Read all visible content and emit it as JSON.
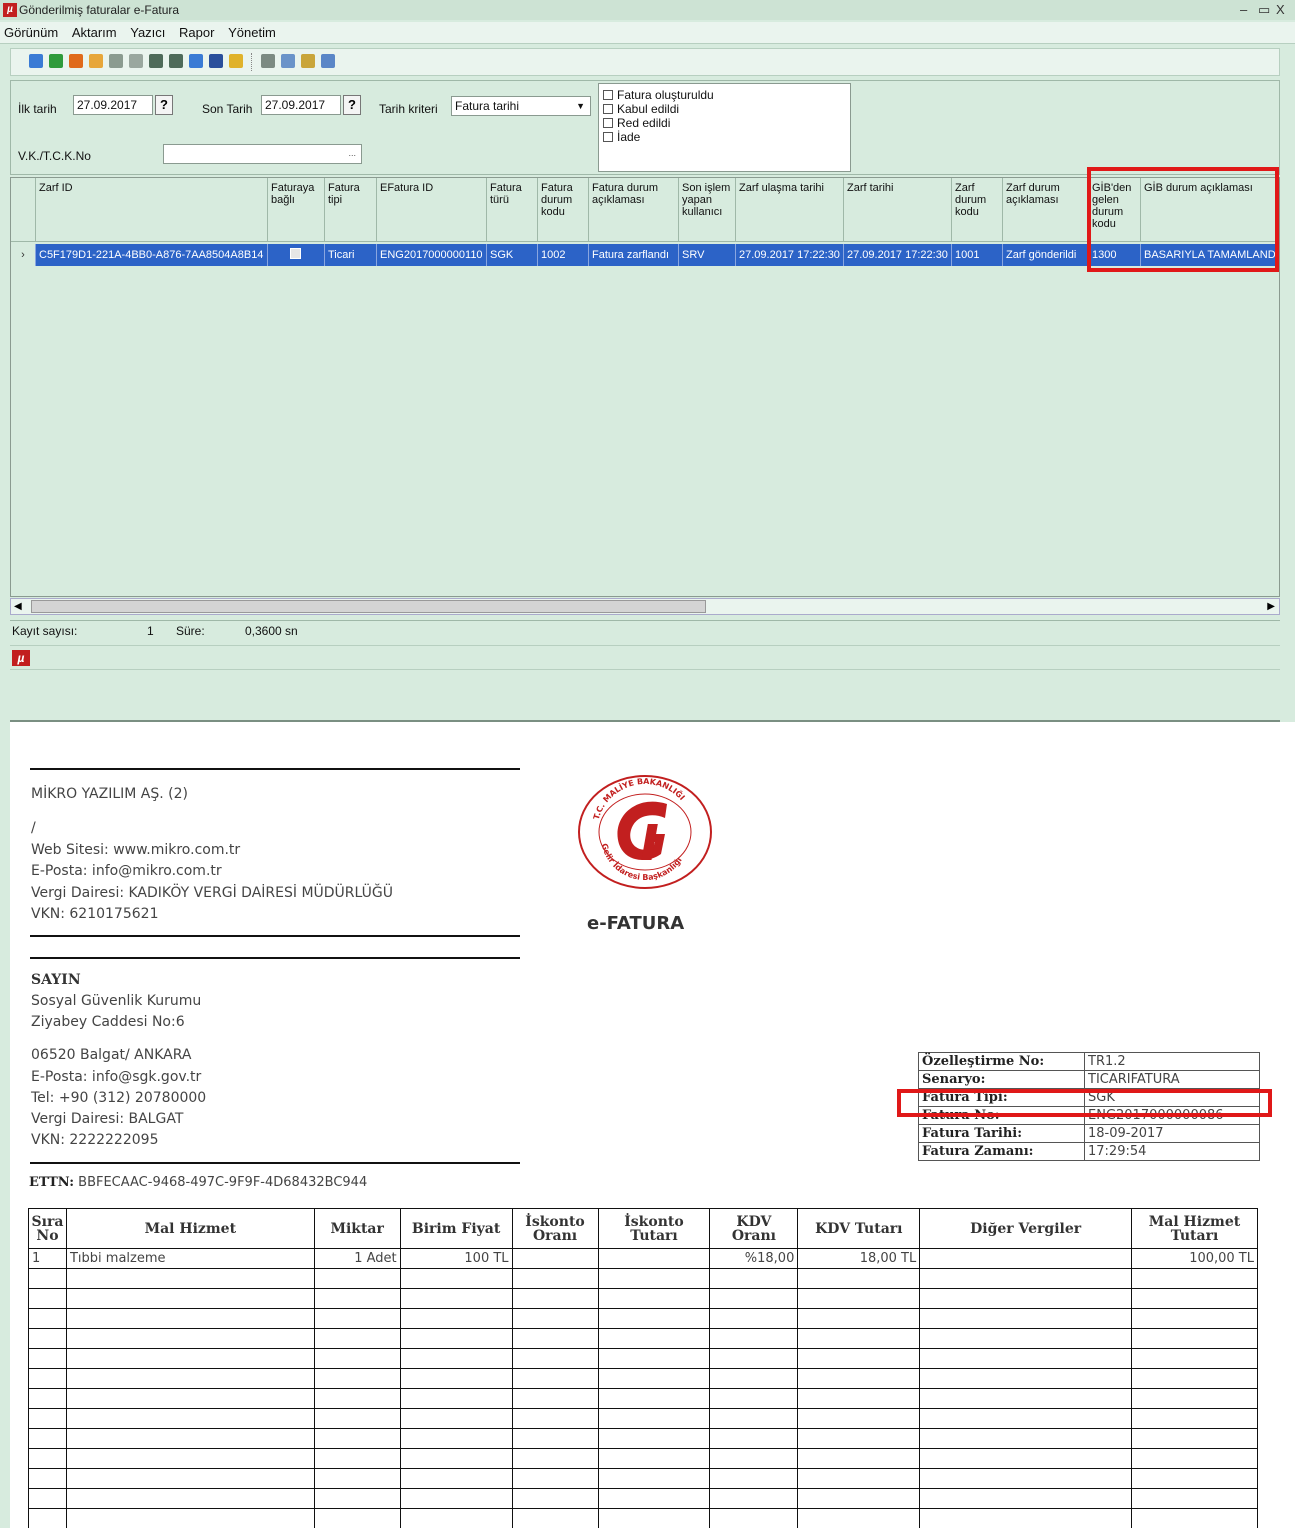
{
  "window": {
    "title": "Gönderilmiş faturalar e-Fatura",
    "controls": [
      "–",
      "▭",
      "X"
    ]
  },
  "menu": [
    "Görünüm",
    "Aktarım",
    "Yazıcı",
    "Rapor",
    "Yönetim"
  ],
  "filters": {
    "ilk_tarih_label": "İlk tarih",
    "ilk_tarih": "27.09.2017",
    "son_tarih_label": "Son Tarih",
    "son_tarih": "27.09.2017",
    "q": "?",
    "tarih_kriteri_label": "Tarih kriteri",
    "tarih_kriteri": "Fatura tarihi",
    "vkn_label": "V.K./T.C.K.No",
    "vkn_value": "",
    "ellipsis": "...",
    "status_options": [
      "Fatura oluşturuldu",
      "Kabul edildi",
      "Red edildi",
      "İade"
    ]
  },
  "grid": {
    "headers": [
      "Zarf ID",
      "Faturaya bağlı",
      "Fatura tipi",
      "EFatura ID",
      "Fatura türü",
      "Fatura durum kodu",
      "Fatura durum açıklaması",
      "Son işlem yapan kullanıcı",
      "Zarf ulaşma tarihi",
      "Zarf tarihi",
      "Zarf durum kodu",
      "Zarf durum açıklaması",
      "GİB'den gelen durum kodu",
      "GİB durum açıklaması"
    ],
    "row": [
      "C5F179D1-221A-4BB0-A876-7AA8504A8B14",
      "",
      "Ticari",
      "ENG2017000000110",
      "SGK",
      "1002",
      "Fatura zarflandı",
      "SRV",
      "27.09.2017 17:22:30",
      "27.09.2017 17:22:30",
      "1001",
      "Zarf gönderildi",
      "1300",
      "BASARIYLA TAMAMLANDI"
    ]
  },
  "status": {
    "kayit_label": "Kayıt sayısı:",
    "kayit": "1",
    "sure_label": "Süre:",
    "sure": "0,3600 sn"
  },
  "invoice": {
    "seller": [
      "MİKRO YAZILIM AŞ. (2)",
      "/",
      "Web Sitesi: www.mikro.com.tr",
      "E-Posta: info@mikro.com.tr",
      "Vergi Dairesi: KADIKÖY VERGİ DAİRESİ MÜDÜRLÜĞÜ",
      "VKN: 6210175621"
    ],
    "logo_top_text": "T.C. MALİYE BAKANLIĞI",
    "logo_bottom_text": "Gelir İdaresi Başkanlığı",
    "efatura": "e-FATURA",
    "sayin": "SAYIN",
    "buyer": [
      "Sosyal Güvenlik Kurumu",
      "Ziyabey Caddesi No:6",
      "06520 Balgat/ ANKARA",
      "E-Posta: info@sgk.gov.tr",
      "Tel: +90 (312) 20780000",
      "Vergi Dairesi: BALGAT",
      "VKN: 2222222095"
    ],
    "ettn_label": "ETTN:",
    "ettn": "BBFECAAC-9468-497C-9F9F-4D68432BC944",
    "info": [
      {
        "k": "Özelleştirme No:",
        "v": "TR1.2"
      },
      {
        "k": "Senaryo:",
        "v": "TICARIFATURA"
      },
      {
        "k": "Fatura Tipi:",
        "v": "SGK"
      },
      {
        "k": "Fatura No:",
        "v": "ENG2017000000086"
      },
      {
        "k": "Fatura Tarihi:",
        "v": "18-09-2017"
      },
      {
        "k": "Fatura Zamanı:",
        "v": "17:29:54"
      }
    ],
    "table_headers": [
      "Sıra No",
      "Mal Hizmet",
      "Miktar",
      "Birim Fiyat",
      "İskonto Oranı",
      "İskonto Tutarı",
      "KDV Oranı",
      "KDV Tutarı",
      "Diğer Vergiler",
      "Mal Hizmet Tutarı"
    ],
    "items": [
      [
        "1",
        "Tıbbi malzeme",
        "1 Adet",
        "100 TL",
        "",
        "",
        "%18,00",
        "18,00 TL",
        "",
        "100,00 TL"
      ]
    ]
  }
}
